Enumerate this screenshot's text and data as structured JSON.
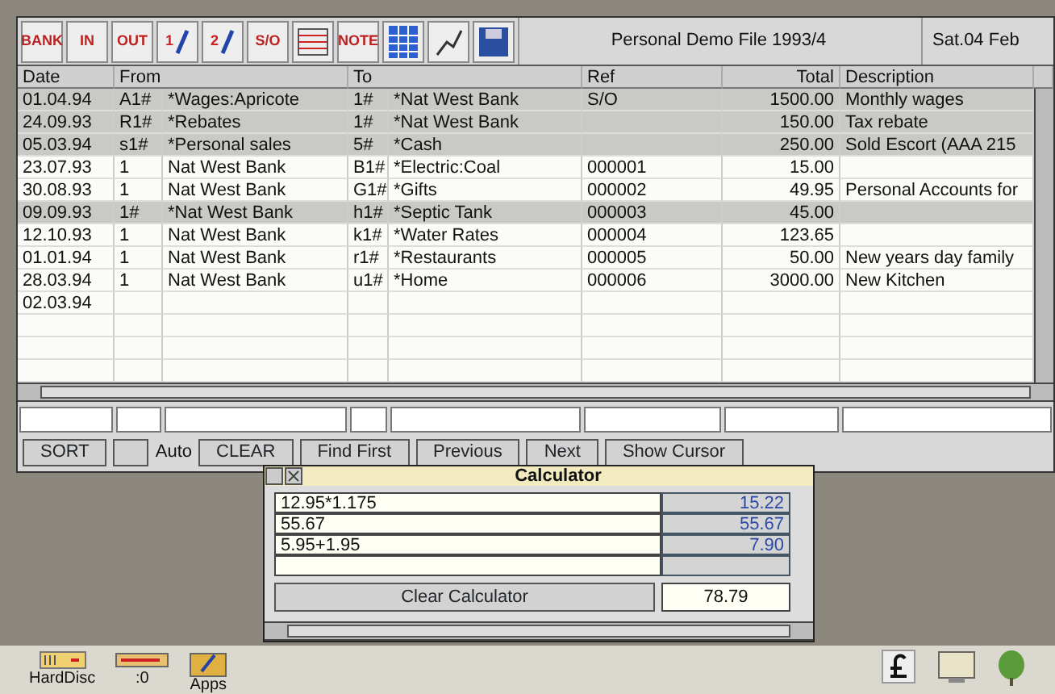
{
  "toolbar": [
    {
      "kind": "text",
      "label": "BANK"
    },
    {
      "kind": "text",
      "label": "IN"
    },
    {
      "kind": "text",
      "label": "OUT"
    },
    {
      "kind": "numbered",
      "label": "1"
    },
    {
      "kind": "numbered",
      "label": "2"
    },
    {
      "kind": "text",
      "label": "S/O"
    },
    {
      "kind": "grid"
    },
    {
      "kind": "text",
      "label": "NOTE"
    },
    {
      "kind": "calculator"
    },
    {
      "kind": "chart"
    },
    {
      "kind": "disc"
    }
  ],
  "window": {
    "title": "Personal Demo File 1993/4",
    "date": "Sat.04 Feb"
  },
  "table": {
    "columns": [
      "Date",
      "From",
      "",
      "To",
      "",
      "Ref",
      "Total",
      "Description"
    ],
    "rows": [
      {
        "highlighted": true,
        "cells": [
          "01.04.94",
          "A1#",
          "*Wages:Apricote",
          "1#",
          "*Nat West Bank",
          "S/O",
          "1500.00",
          "Monthly wages"
        ]
      },
      {
        "highlighted": true,
        "cells": [
          "24.09.93",
          "R1#",
          "*Rebates",
          "1#",
          "*Nat West Bank",
          "",
          "150.00",
          "Tax rebate"
        ]
      },
      {
        "highlighted": true,
        "cells": [
          "05.03.94",
          "s1#",
          "*Personal sales",
          "5#",
          "*Cash",
          "",
          "250.00",
          "Sold Escort (AAA 215"
        ]
      },
      {
        "highlighted": false,
        "cells": [
          "23.07.93",
          "1",
          "Nat West Bank",
          "B1#",
          "*Electric:Coal",
          "000001",
          "15.00",
          ""
        ]
      },
      {
        "highlighted": false,
        "cells": [
          "30.08.93",
          "1",
          "Nat West Bank",
          "G1#",
          "*Gifts",
          "000002",
          "49.95",
          "Personal Accounts for"
        ]
      },
      {
        "highlighted": true,
        "cells": [
          "09.09.93",
          "1#",
          "*Nat West Bank",
          "h1#",
          "*Septic Tank",
          "000003",
          "45.00",
          ""
        ]
      },
      {
        "highlighted": false,
        "cells": [
          "12.10.93",
          "1",
          "Nat West Bank",
          "k1#",
          "*Water Rates",
          "000004",
          "123.65",
          ""
        ]
      },
      {
        "highlighted": false,
        "cells": [
          "01.01.94",
          "1",
          "Nat West Bank",
          "r1#",
          "*Restaurants",
          "000005",
          "50.00",
          "New years day family"
        ]
      },
      {
        "highlighted": false,
        "cells": [
          "28.03.94",
          "1",
          "Nat West Bank",
          "u1#",
          "*Home",
          "000006",
          "3000.00",
          "New Kitchen"
        ]
      },
      {
        "highlighted": false,
        "cells": [
          "02.03.94",
          "",
          "",
          "",
          "",
          "",
          "",
          ""
        ]
      }
    ]
  },
  "buttons": [
    {
      "kind": "button",
      "label": "SORT"
    },
    {
      "kind": "toggle"
    },
    {
      "kind": "label",
      "label": "Auto"
    },
    {
      "kind": "button",
      "label": "CLEAR"
    },
    {
      "kind": "button",
      "label": "Find First"
    },
    {
      "kind": "button",
      "label": "Previous"
    },
    {
      "kind": "button",
      "label": "Next"
    },
    {
      "kind": "button",
      "label": "Show Cursor"
    }
  ],
  "calculator": {
    "title": "Calculator",
    "lines": [
      {
        "expression": "12.95*1.175",
        "result": "15.22"
      },
      {
        "expression": "55.67",
        "result": "55.67"
      },
      {
        "expression": "5.95+1.95",
        "result": "7.90"
      }
    ],
    "clear_button": "Clear Calculator",
    "total": "78.79"
  },
  "iconbar": {
    "left": [
      {
        "kind": "disc",
        "label": "HardDisc"
      },
      {
        "kind": "ram",
        "label": ":0"
      },
      {
        "kind": "apps",
        "label": "Apps"
      }
    ],
    "right": [
      {
        "kind": "pound"
      },
      {
        "kind": "monitor"
      },
      {
        "kind": "acorn"
      }
    ]
  }
}
